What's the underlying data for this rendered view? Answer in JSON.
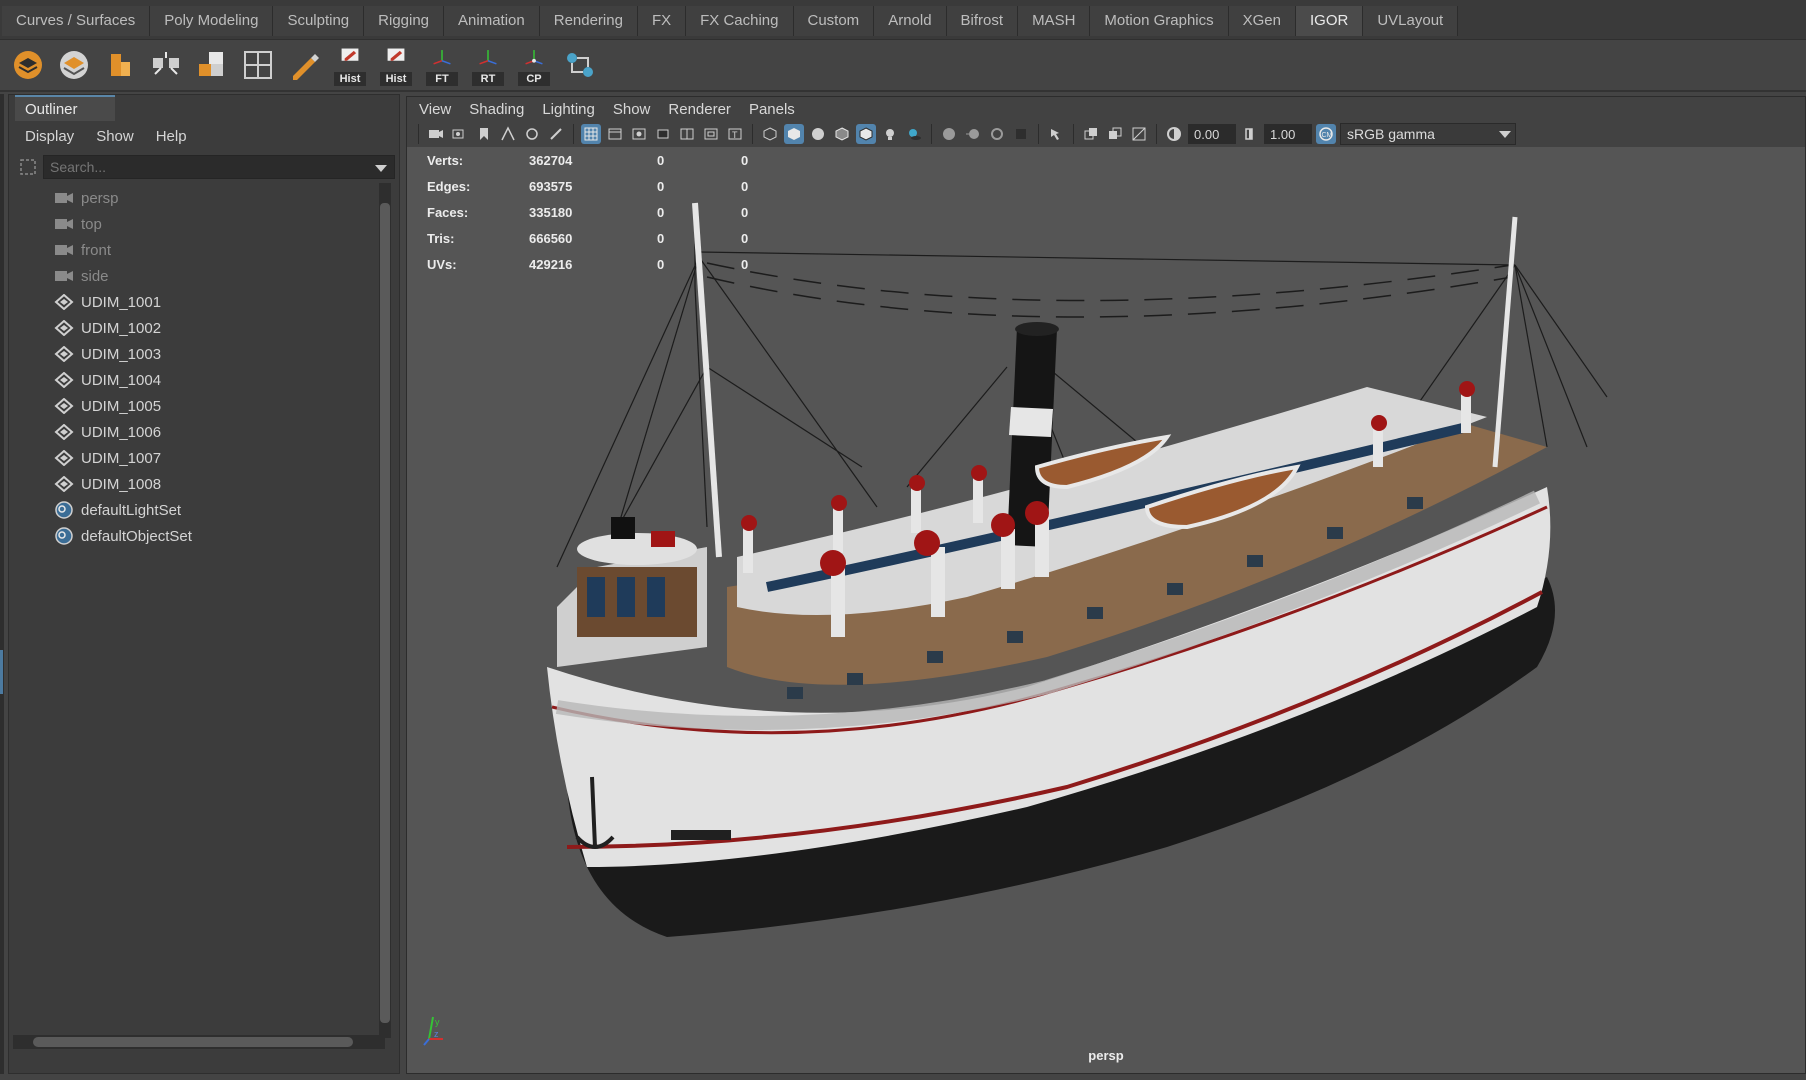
{
  "shelf": {
    "tabs": [
      "Curves / Surfaces",
      "Poly Modeling",
      "Sculpting",
      "Rigging",
      "Animation",
      "Rendering",
      "FX",
      "FX Caching",
      "Custom",
      "Arnold",
      "Bifrost",
      "MASH",
      "Motion Graphics",
      "XGen",
      "IGOR",
      "UVLayout"
    ],
    "active_tab": "IGOR",
    "buttons": [
      {
        "icon": "orange-layers-icon",
        "caption": ""
      },
      {
        "icon": "layers-stack-icon",
        "caption": ""
      },
      {
        "icon": "orange-blocks-icon",
        "caption": ""
      },
      {
        "icon": "arrows-grid-icon",
        "caption": ""
      },
      {
        "icon": "quad-squares-icon",
        "caption": ""
      },
      {
        "icon": "grid-split-icon",
        "caption": ""
      },
      {
        "icon": "pencil-brush-icon",
        "caption": ""
      },
      {
        "icon": "history-edit-icon",
        "caption": "Hist"
      },
      {
        "icon": "history-edit-icon",
        "caption": "Hist"
      },
      {
        "icon": "axis-freeze-icon",
        "caption": "FT"
      },
      {
        "icon": "axis-reset-icon",
        "caption": "RT"
      },
      {
        "icon": "axis-center-pivot-icon",
        "caption": "CP"
      },
      {
        "icon": "transfer-nodes-icon",
        "caption": ""
      }
    ]
  },
  "outliner": {
    "title": "Outliner",
    "menu": [
      "Display",
      "Show",
      "Help"
    ],
    "search_placeholder": "Search...",
    "items": [
      {
        "label": "persp",
        "icon": "camera-icon",
        "dim": true
      },
      {
        "label": "top",
        "icon": "camera-icon",
        "dim": true
      },
      {
        "label": "front",
        "icon": "camera-icon",
        "dim": true
      },
      {
        "label": "side",
        "icon": "camera-icon",
        "dim": true
      },
      {
        "label": "UDIM_1001",
        "icon": "mesh-transform-icon",
        "dim": false
      },
      {
        "label": "UDIM_1002",
        "icon": "mesh-transform-icon",
        "dim": false
      },
      {
        "label": "UDIM_1003",
        "icon": "mesh-transform-icon",
        "dim": false
      },
      {
        "label": "UDIM_1004",
        "icon": "mesh-transform-icon",
        "dim": false
      },
      {
        "label": "UDIM_1005",
        "icon": "mesh-transform-icon",
        "dim": false
      },
      {
        "label": "UDIM_1006",
        "icon": "mesh-transform-icon",
        "dim": false
      },
      {
        "label": "UDIM_1007",
        "icon": "mesh-transform-icon",
        "dim": false
      },
      {
        "label": "UDIM_1008",
        "icon": "mesh-transform-icon",
        "dim": false
      },
      {
        "label": "defaultLightSet",
        "icon": "set-icon",
        "dim": false
      },
      {
        "label": "defaultObjectSet",
        "icon": "set-icon",
        "dim": false
      }
    ]
  },
  "viewport": {
    "menu": [
      "View",
      "Shading",
      "Lighting",
      "Show",
      "Renderer",
      "Panels"
    ],
    "exposure": "0.00",
    "gamma": "1.00",
    "color_space": "sRGB gamma",
    "camera": "persp",
    "hud": [
      {
        "label": "Verts:",
        "v1": "362704",
        "v2": "0",
        "v3": "0"
      },
      {
        "label": "Edges:",
        "v1": "693575",
        "v2": "0",
        "v3": "0"
      },
      {
        "label": "Faces:",
        "v1": "335180",
        "v2": "0",
        "v3": "0"
      },
      {
        "label": "Tris:",
        "v1": "666560",
        "v2": "0",
        "v3": "0"
      },
      {
        "label": "UVs:",
        "v1": "429216",
        "v2": "0",
        "v3": "0"
      }
    ]
  },
  "colors": {
    "accent": "#5284ad",
    "hull_dark": "#1a1a1a",
    "hull_white": "#e8e8e8",
    "trim_red": "#8e1a1a",
    "deck_wood": "#8a6a4c"
  }
}
